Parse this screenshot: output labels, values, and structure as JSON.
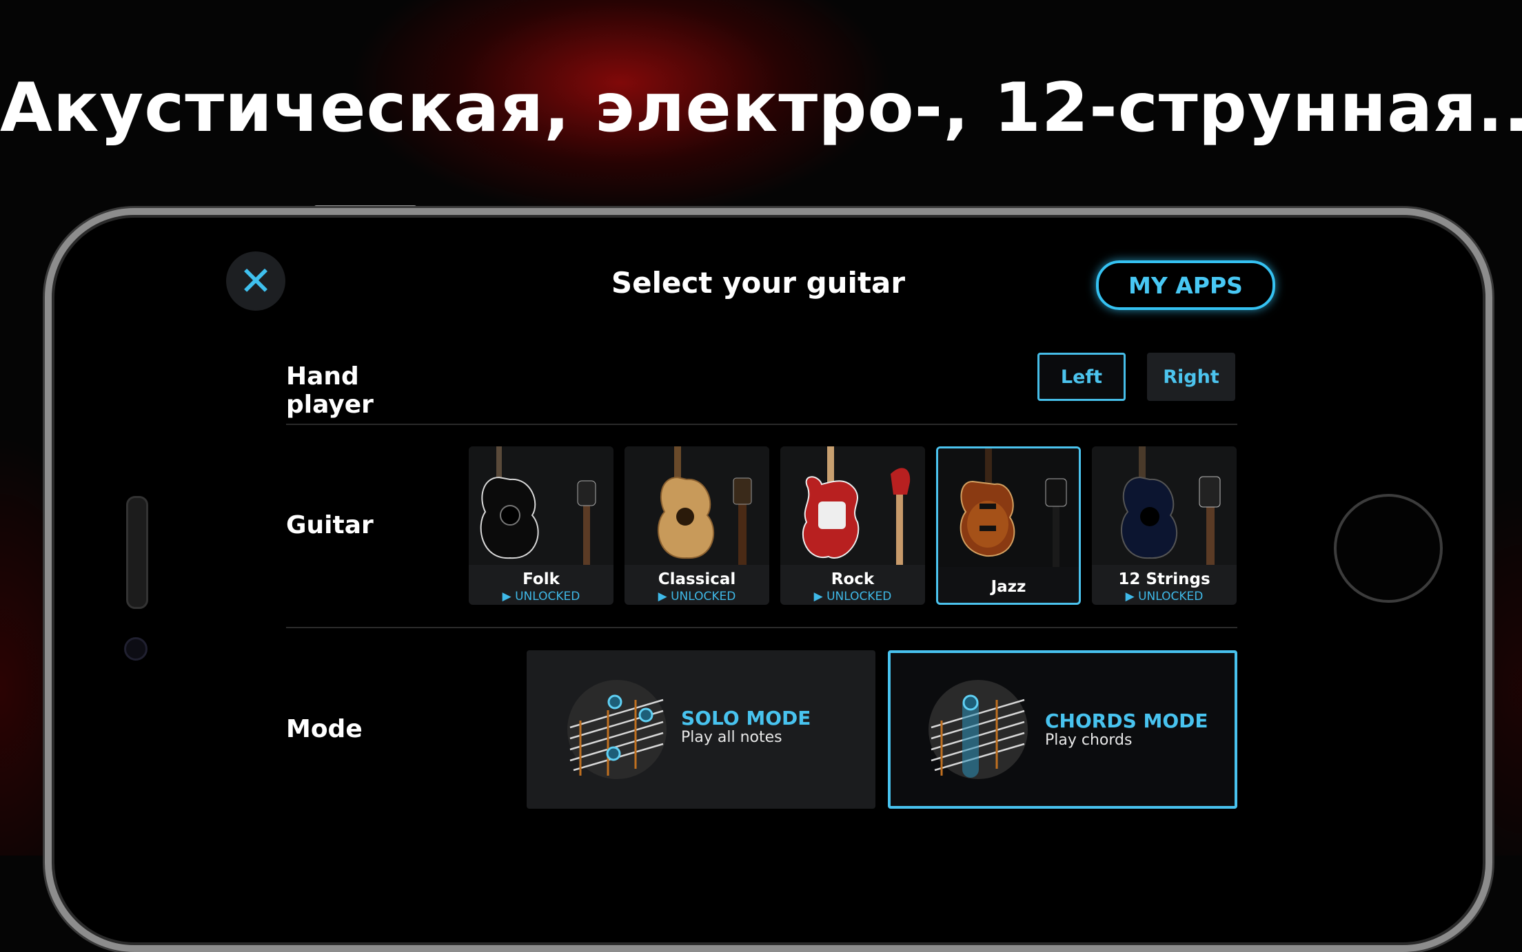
{
  "headline": "Акустическая, электро-, 12-струнная...",
  "screen": {
    "title": "Select your guitar",
    "close_icon": "close-icon",
    "my_apps_label": "MY APPS"
  },
  "hand_player": {
    "label": "Hand player",
    "options": [
      "Left",
      "Right"
    ],
    "selected": "Left"
  },
  "guitar": {
    "label": "Guitar",
    "items": [
      {
        "name": "Folk",
        "status": "▶ UNLOCKED",
        "selected": false
      },
      {
        "name": "Classical",
        "status": "▶ UNLOCKED",
        "selected": false
      },
      {
        "name": "Rock",
        "status": "▶ UNLOCKED",
        "selected": false
      },
      {
        "name": "Jazz",
        "status": "",
        "selected": true
      },
      {
        "name": "12 Strings",
        "status": "▶ UNLOCKED",
        "selected": false
      }
    ]
  },
  "mode": {
    "label": "Mode",
    "items": [
      {
        "title": "SOLO MODE",
        "subtitle": "Play all notes",
        "selected": false
      },
      {
        "title": "CHORDS MODE",
        "subtitle": "Play chords",
        "selected": true
      }
    ]
  },
  "colors": {
    "accent": "#48c3ef",
    "background": "#000000",
    "card": "#1b1c1e"
  }
}
